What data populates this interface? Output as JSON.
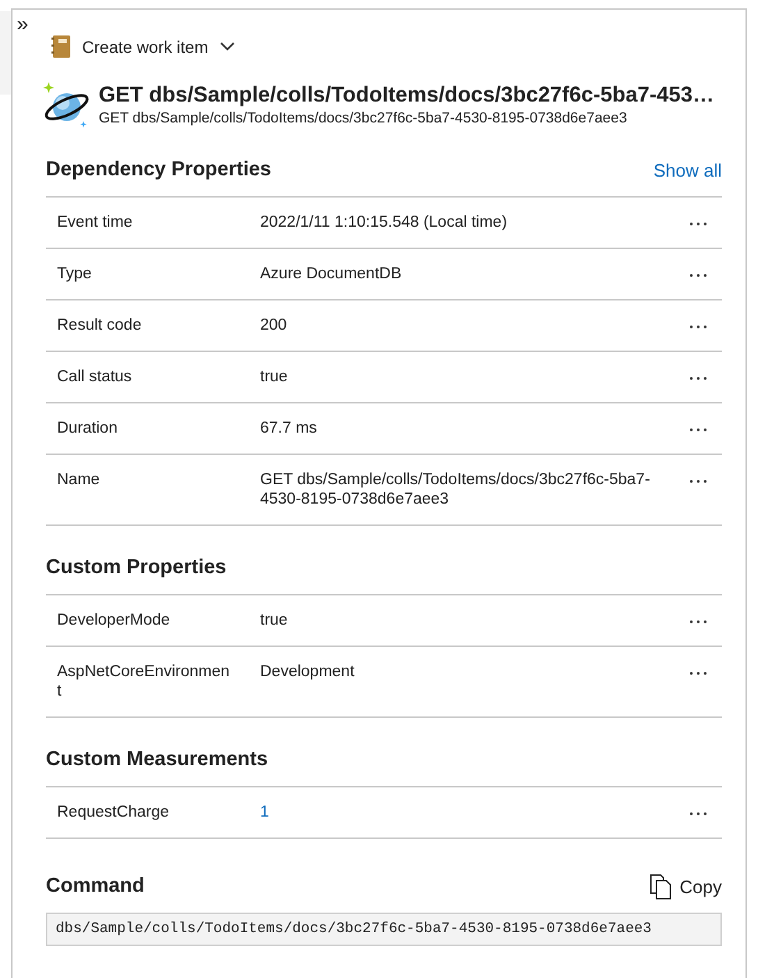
{
  "expand_glyph": "»",
  "toolbar": {
    "create_label": "Create work item"
  },
  "title": "GET dbs/Sample/colls/TodoItems/docs/3bc27f6c-5ba7-453…",
  "subtitle": "GET dbs/Sample/colls/TodoItems/docs/3bc27f6c-5ba7-4530-8195-0738d6e7aee3",
  "sections": [
    {
      "title": "Dependency Properties",
      "action": "Show all",
      "rows": [
        {
          "name": "Event time",
          "value": "2022/1/11 1:10:15.548 (Local time)",
          "kind": "text"
        },
        {
          "name": "Type",
          "value": "Azure DocumentDB",
          "kind": "text"
        },
        {
          "name": "Result code",
          "value": "200",
          "kind": "text"
        },
        {
          "name": "Call status",
          "value": "true",
          "kind": "text"
        },
        {
          "name": "Duration",
          "value": "67.7 ms",
          "kind": "text"
        },
        {
          "name": "Name",
          "value": "GET dbs/Sample/colls/TodoItems/docs/3bc27f6c-5ba7-4530-8195-0738d6e7aee3",
          "kind": "text"
        }
      ]
    },
    {
      "title": "Custom Properties",
      "rows": [
        {
          "name": "DeveloperMode",
          "value": "true",
          "kind": "text"
        },
        {
          "name": "AspNetCoreEnvironment",
          "value": "Development",
          "kind": "text"
        }
      ]
    },
    {
      "title": "Custom Measurements",
      "rows": [
        {
          "name": "RequestCharge",
          "value": "1",
          "kind": "link"
        }
      ]
    }
  ],
  "command": {
    "title": "Command",
    "copy_label": "Copy",
    "text": "dbs/Sample/colls/TodoItems/docs/3bc27f6c-5ba7-4530-8195-0738d6e7aee3"
  }
}
